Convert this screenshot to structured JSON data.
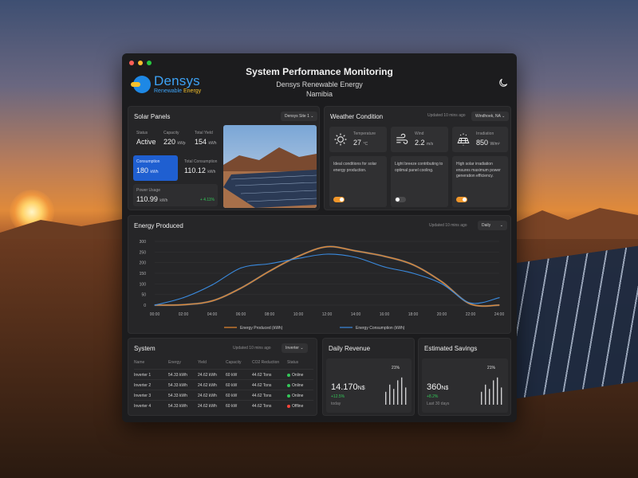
{
  "header": {
    "title": "System Performance Monitoring",
    "company": "Densys Renewable Energy",
    "country": "Namibia",
    "logo_name": "Densys",
    "logo_sub_1": "Renewable",
    "logo_sub_2": "Energy"
  },
  "window_controls": {
    "colors": [
      "#ff5f57",
      "#febc2e",
      "#28c840"
    ]
  },
  "solar": {
    "title": "Solar Panels",
    "site": "Densys Site 1",
    "status_label": "Status",
    "status_value": "Active",
    "capacity_label": "Capacity",
    "capacity_value": "220",
    "capacity_unit": "kWp",
    "yield_label": "Total Yield",
    "yield_value": "154",
    "yield_unit": "kWh",
    "consumption_label": "Consumption",
    "consumption_value": "180",
    "consumption_unit": "kWh",
    "total_consumption_label": "Total Consumption",
    "total_consumption_value": "110.12",
    "total_consumption_unit": "kWh",
    "power_usage_label": "Power Usage",
    "power_usage_value": "110.99",
    "power_usage_unit": "kWh",
    "power_usage_delta": "+ 4.11%"
  },
  "weather": {
    "title": "Weather Condition",
    "updated": "Updated 10 mins ago",
    "location": "Windhoek, NA",
    "items": [
      {
        "label": "Temperature",
        "value": "27",
        "unit": "°C",
        "note": "Ideal conditions for solar energy production.",
        "toggle_on": true
      },
      {
        "label": "Wind",
        "value": "2.2",
        "unit": "m/s",
        "note": "Light breeze contributing to optimal panel cooling.",
        "toggle_on": false
      },
      {
        "label": "Irradiation",
        "value": "850",
        "unit": "W/m²",
        "note": "High solar irradiation ensures maximum power generation efficiency.",
        "toggle_on": true
      }
    ]
  },
  "energy": {
    "title": "Energy Produced",
    "updated": "Updated 10 mins ago",
    "period": "Daily"
  },
  "chart_data": {
    "type": "line",
    "x": [
      "00:00",
      "02:00",
      "04:00",
      "06:00",
      "08:00",
      "10:00",
      "12:00",
      "14:00",
      "16:00",
      "18:00",
      "20:00",
      "22:00",
      "24:00"
    ],
    "ylim": [
      0,
      300
    ],
    "yticks": [
      0,
      50,
      100,
      150,
      200,
      250,
      300
    ],
    "series": [
      {
        "name": "Energy Produced (kWh)",
        "color": "#e8892f",
        "values": [
          0,
          2,
          20,
          80,
          160,
          230,
          275,
          255,
          230,
          190,
          110,
          5,
          0
        ]
      },
      {
        "name": "Energy Consumption (kWh)",
        "color": "#3a8be0",
        "values": [
          0,
          35,
          95,
          175,
          195,
          220,
          240,
          225,
          180,
          150,
          100,
          10,
          35
        ]
      }
    ],
    "grid": true,
    "legend": "bottom"
  },
  "system": {
    "title": "System",
    "updated": "Updated 10 mins ago",
    "filter": "Inverter",
    "columns": [
      "Name",
      "Energy",
      "Yield",
      "Capacity",
      "CO2 Reduction",
      "Status"
    ],
    "rows": [
      [
        "Inverter 1",
        "54.33 kWh",
        "24.62 kWh",
        "60 kW",
        "44.62 Tons",
        "Online"
      ],
      [
        "Inverter 2",
        "54.33 kWh",
        "24.62 kWh",
        "60 kW",
        "44.62 Tons",
        "Online"
      ],
      [
        "Inverter 3",
        "54.33 kWh",
        "24.62 kWh",
        "60 kW",
        "44.62 Tons",
        "Online"
      ],
      [
        "Inverter 4",
        "54.33 kWh",
        "24.62 kWh",
        "60 kW",
        "44.62 Tons",
        "Offline"
      ]
    ],
    "status_colors": {
      "Online": "#34c759",
      "Offline": "#ff453a"
    }
  },
  "revenue": {
    "title": "Daily Revenue",
    "value": "14.170",
    "unit": "N$",
    "delta": "+12.5%",
    "period": "today",
    "badge": "21%",
    "bars": [
      0.45,
      0.7,
      0.55,
      0.85,
      0.95,
      0.6
    ]
  },
  "savings": {
    "title": "Estimated Savings",
    "value": "360",
    "unit": "N$",
    "delta": "+8.2%",
    "period": "Last 30 days",
    "badge": "21%",
    "bars": [
      0.45,
      0.7,
      0.55,
      0.85,
      0.95,
      0.6
    ]
  }
}
